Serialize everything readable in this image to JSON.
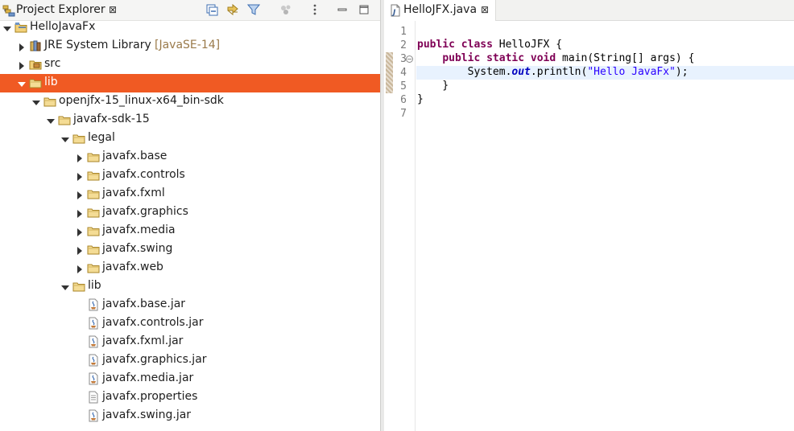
{
  "explorer": {
    "title": "Project Explorer",
    "close": "⊠",
    "toolbar": [
      "collapse-all-icon",
      "link-with-editor-icon",
      "filter-icon",
      "focus-icon",
      "view-menu-icon",
      "minimize-icon",
      "maximize-icon"
    ],
    "tree": [
      {
        "label": "HelloJavaFx",
        "deco": "",
        "depth": 0,
        "expanded": true,
        "icon": "project",
        "selected": false
      },
      {
        "label": "JRE System Library",
        "deco": "[JavaSE-14]",
        "depth": 1,
        "expanded": false,
        "icon": "library",
        "selected": false
      },
      {
        "label": "src",
        "deco": "",
        "depth": 1,
        "expanded": false,
        "icon": "package-folder",
        "selected": false
      },
      {
        "label": "lib",
        "deco": "",
        "depth": 1,
        "expanded": true,
        "icon": "folder",
        "selected": true
      },
      {
        "label": "openjfx-15_linux-x64_bin-sdk",
        "deco": "",
        "depth": 2,
        "expanded": true,
        "icon": "folder",
        "selected": false
      },
      {
        "label": "javafx-sdk-15",
        "deco": "",
        "depth": 3,
        "expanded": true,
        "icon": "folder",
        "selected": false
      },
      {
        "label": "legal",
        "deco": "",
        "depth": 4,
        "expanded": true,
        "icon": "folder",
        "selected": false
      },
      {
        "label": "javafx.base",
        "deco": "",
        "depth": 5,
        "expanded": false,
        "icon": "folder",
        "selected": false
      },
      {
        "label": "javafx.controls",
        "deco": "",
        "depth": 5,
        "expanded": false,
        "icon": "folder",
        "selected": false
      },
      {
        "label": "javafx.fxml",
        "deco": "",
        "depth": 5,
        "expanded": false,
        "icon": "folder",
        "selected": false
      },
      {
        "label": "javafx.graphics",
        "deco": "",
        "depth": 5,
        "expanded": false,
        "icon": "folder",
        "selected": false
      },
      {
        "label": "javafx.media",
        "deco": "",
        "depth": 5,
        "expanded": false,
        "icon": "folder",
        "selected": false
      },
      {
        "label": "javafx.swing",
        "deco": "",
        "depth": 5,
        "expanded": false,
        "icon": "folder",
        "selected": false
      },
      {
        "label": "javafx.web",
        "deco": "",
        "depth": 5,
        "expanded": false,
        "icon": "folder",
        "selected": false
      },
      {
        "label": "lib",
        "deco": "",
        "depth": 4,
        "expanded": true,
        "icon": "folder",
        "selected": false
      },
      {
        "label": "javafx.base.jar",
        "deco": "",
        "depth": 5,
        "expanded": null,
        "icon": "jar",
        "selected": false
      },
      {
        "label": "javafx.controls.jar",
        "deco": "",
        "depth": 5,
        "expanded": null,
        "icon": "jar",
        "selected": false
      },
      {
        "label": "javafx.fxml.jar",
        "deco": "",
        "depth": 5,
        "expanded": null,
        "icon": "jar",
        "selected": false
      },
      {
        "label": "javafx.graphics.jar",
        "deco": "",
        "depth": 5,
        "expanded": null,
        "icon": "jar",
        "selected": false
      },
      {
        "label": "javafx.media.jar",
        "deco": "",
        "depth": 5,
        "expanded": null,
        "icon": "jar",
        "selected": false
      },
      {
        "label": "javafx.properties",
        "deco": "",
        "depth": 5,
        "expanded": null,
        "icon": "text-file",
        "selected": false
      },
      {
        "label": "javafx.swing.jar",
        "deco": "",
        "depth": 5,
        "expanded": null,
        "icon": "jar",
        "selected": false
      }
    ]
  },
  "editor": {
    "tab_label": "HelloJFX.java",
    "tab_close": "⊠",
    "tab_icon": "java-file-icon",
    "current_line": 4,
    "lines": [
      {
        "no": "1",
        "tokens": []
      },
      {
        "no": "2",
        "tokens": [
          [
            "kw",
            "public"
          ],
          [
            "plain",
            " "
          ],
          [
            "kw",
            "class"
          ],
          [
            "plain",
            " HelloJFX {"
          ]
        ]
      },
      {
        "no": "3",
        "tokens": [
          [
            "plain",
            "    "
          ],
          [
            "kw",
            "public"
          ],
          [
            "plain",
            " "
          ],
          [
            "kw",
            "static"
          ],
          [
            "plain",
            " "
          ],
          [
            "kw",
            "void"
          ],
          [
            "plain",
            " main(String[] args) {"
          ]
        ]
      },
      {
        "no": "4",
        "tokens": [
          [
            "plain",
            "        System."
          ],
          [
            "fld",
            "out"
          ],
          [
            "plain",
            ".println("
          ],
          [
            "str",
            "\"Hello JavaFx\""
          ],
          [
            "plain",
            ");"
          ]
        ]
      },
      {
        "no": "5",
        "tokens": [
          [
            "plain",
            "    }"
          ]
        ]
      },
      {
        "no": "6",
        "tokens": [
          [
            "plain",
            "}"
          ]
        ]
      },
      {
        "no": "7",
        "tokens": []
      }
    ]
  },
  "colors": {
    "selection": "#f05a23",
    "keyword": "#7f0055",
    "string": "#2a00ff",
    "field": "#0000c0",
    "current_line": "#e8f2fe"
  }
}
